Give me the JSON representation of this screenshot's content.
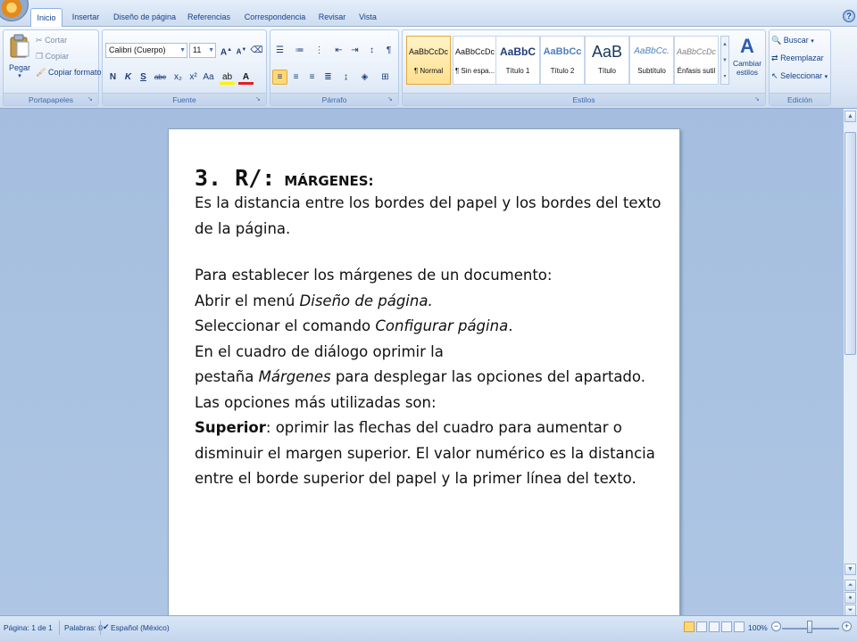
{
  "tabs": [
    "Inicio",
    "Insertar",
    "Diseño de página",
    "Referencias",
    "Correspondencia",
    "Revisar",
    "Vista"
  ],
  "clipboard": {
    "paste": "Pegar",
    "cut": "Cortar",
    "copy": "Copiar",
    "format_painter": "Copiar formato",
    "label": "Portapapeles"
  },
  "font": {
    "name": "Calibri (Cuerpo)",
    "size": "11",
    "label": "Fuente",
    "bold": "N",
    "italic": "K",
    "underline": "S",
    "strike": "abe",
    "subscript": "x₂",
    "superscript": "x²",
    "case": "Aa"
  },
  "paragraph": {
    "label": "Párrafo"
  },
  "styles": {
    "label": "Estilos",
    "items": [
      {
        "sample": "AaBbCcDc",
        "name": "¶ Normal"
      },
      {
        "sample": "AaBbCcDc",
        "name": "¶ Sin espa..."
      },
      {
        "sample": "AaBbC",
        "name": "Título 1"
      },
      {
        "sample": "AaBbCc",
        "name": "Título 2"
      },
      {
        "sample": "AaB",
        "name": "Título"
      },
      {
        "sample": "AaBbCc.",
        "name": "Subtítulo"
      },
      {
        "sample": "AaBbCcDc",
        "name": "Énfasis sutil"
      }
    ],
    "change_styles": "Cambiar estilos"
  },
  "editing": {
    "find": "Buscar",
    "replace": "Reemplazar",
    "select": "Seleccionar",
    "label": "Edición"
  },
  "document": {
    "heading_num": "3. R/:",
    "heading_sub": "MÁRGENES:",
    "p1": "Es la distancia entre los bordes del papel y los bordes del texto de la página.",
    "p2": "Para establecer los márgenes de un documento:",
    "p3a": "Abrir el menú ",
    "p3b": "Diseño de página.",
    "p4a": "Seleccionar el comando ",
    "p4b": "Configurar página",
    "p4c": ".",
    "p5a": "En el cuadro de diálogo oprimir la",
    "p5b": "pestaña ",
    "p5c": "Márgenes",
    "p5d": " para desplegar las opciones del apartado.",
    "p6": "Las opciones más utilizadas son:",
    "p7a": "Superior",
    "p7b": ": oprimir las flechas del cuadro para aumentar o disminuir el margen superior. El valor numérico es la distancia entre el borde superior del papel y la primer línea del texto."
  },
  "status": {
    "page": "Página: 1 de 1",
    "words": "Palabras: 0",
    "language": "Español (México)",
    "zoom": "100%"
  }
}
